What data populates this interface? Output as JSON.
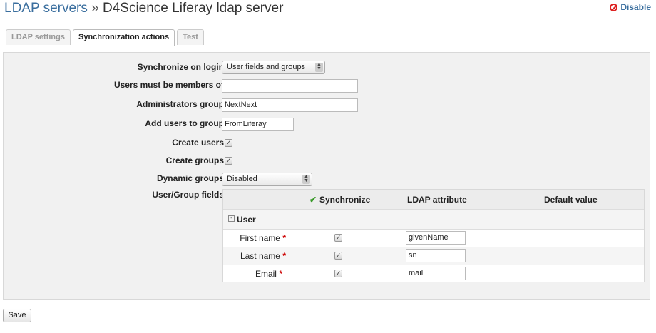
{
  "header": {
    "breadcrumb_link": "LDAP servers",
    "separator": " » ",
    "server_name": "D4Science Liferay ldap server",
    "disable_label": "Disable"
  },
  "tabs": [
    {
      "label": "LDAP settings",
      "active": false
    },
    {
      "label": "Synchronization actions",
      "active": true
    },
    {
      "label": "Test",
      "active": false
    }
  ],
  "form": {
    "sync_on_login": {
      "label": "Synchronize on login",
      "value": "User fields and groups"
    },
    "users_members_of": {
      "label": "Users must be members of",
      "value": ""
    },
    "admin_group": {
      "label": "Administrators group",
      "value": "NextNext"
    },
    "add_users_to_group": {
      "label": "Add users to group",
      "value": "FromLiferay"
    },
    "create_users": {
      "label": "Create users",
      "checked": true
    },
    "create_groups": {
      "label": "Create groups",
      "checked": true
    },
    "dynamic_groups": {
      "label": "Dynamic groups",
      "value": "Disabled"
    },
    "user_group_fields": {
      "label": "User/Group fields"
    }
  },
  "fields_table": {
    "headers": {
      "synchronize": "Synchronize",
      "ldap_attribute": "LDAP attribute",
      "default_value": "Default value"
    },
    "group_label": "User",
    "rows": [
      {
        "name": "First name",
        "required_mark": "*",
        "synchronize": true,
        "attribute": "givenName"
      },
      {
        "name": "Last name",
        "required_mark": "*",
        "synchronize": true,
        "attribute": "sn"
      },
      {
        "name": "Email",
        "required_mark": "*",
        "synchronize": true,
        "attribute": "mail"
      }
    ]
  },
  "save_label": "Save",
  "colors": {
    "link": "#3a6e9e",
    "required": "#cc0000",
    "check_green": "#3a9a2a"
  }
}
